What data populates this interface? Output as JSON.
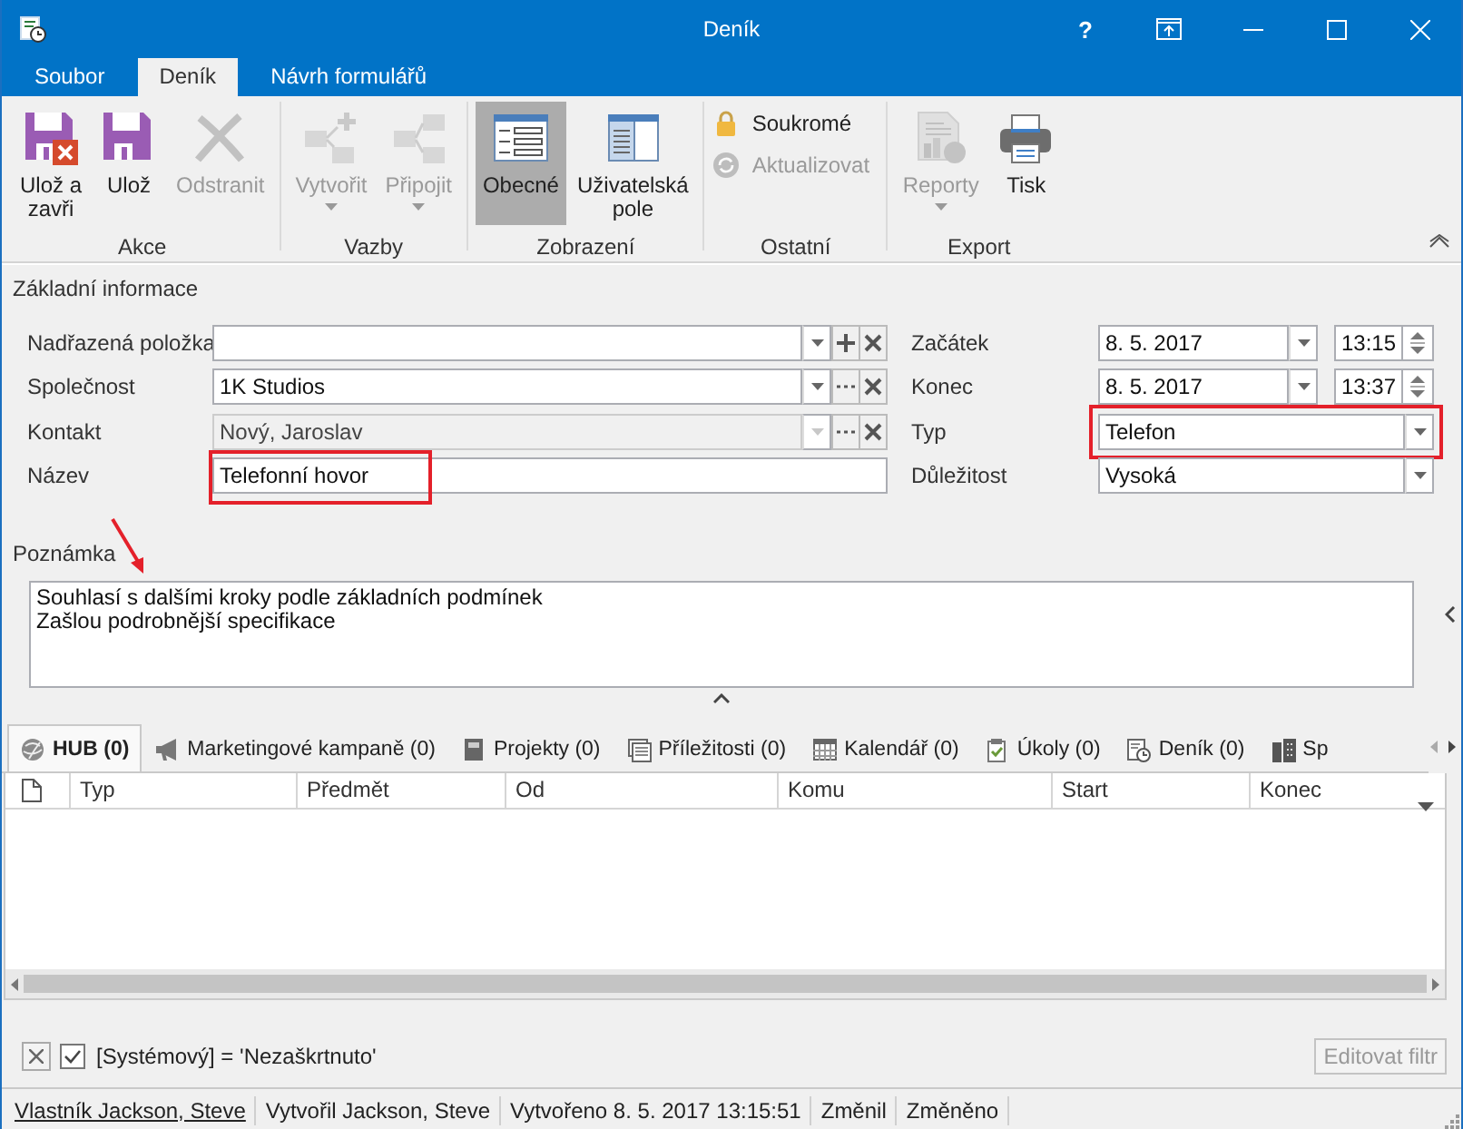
{
  "window": {
    "title": "Deník",
    "help": "?"
  },
  "ribbon": {
    "tabs": [
      {
        "label": "Soubor",
        "selected": false
      },
      {
        "label": "Deník",
        "selected": true
      },
      {
        "label": "Návrh formulářů",
        "selected": false
      }
    ],
    "groups": [
      {
        "label": "Akce",
        "buttons": [
          {
            "kind": "large",
            "label": "Ulož a\nzavři",
            "disabled": false
          },
          {
            "kind": "large",
            "label": "Ulož",
            "disabled": false
          },
          {
            "kind": "large",
            "label": "Odstranit",
            "disabled": true
          }
        ]
      },
      {
        "label": "Vazby",
        "buttons": [
          {
            "kind": "large",
            "label": "Vytvořit",
            "disabled": true,
            "dropdown": true
          },
          {
            "kind": "large",
            "label": "Připojit",
            "disabled": true,
            "dropdown": true
          }
        ]
      },
      {
        "label": "Zobrazení",
        "buttons": [
          {
            "kind": "large",
            "label": "Obecné",
            "disabled": false,
            "selected": true
          },
          {
            "kind": "large",
            "label": "Uživatelská\npole",
            "disabled": false,
            "selected": false
          }
        ]
      },
      {
        "label": "Ostatní",
        "buttons": [
          {
            "kind": "small",
            "label": "Soukromé",
            "disabled": false
          },
          {
            "kind": "small",
            "label": "Aktualizovat",
            "disabled": true
          }
        ]
      },
      {
        "label": "Export",
        "buttons": [
          {
            "kind": "large",
            "label": "Reporty",
            "disabled": true,
            "dropdown": true
          },
          {
            "kind": "large",
            "label": "Tisk",
            "disabled": false
          }
        ]
      }
    ]
  },
  "form": {
    "section": "Základní informace",
    "left": [
      {
        "label": "Nadřazená položka",
        "kind": "lookup",
        "disabled": false,
        "highlighted": false
      },
      {
        "label": "Společnost",
        "kind": "lookup",
        "value": "1K Studios",
        "disabled": false,
        "highlighted": false
      },
      {
        "label": "Kontakt",
        "kind": "lookup",
        "value": "Nový, Jaroslav",
        "disabled": true,
        "highlighted": false
      },
      {
        "label": "Název",
        "kind": "text",
        "value": "Telefonní hovor",
        "disabled": false,
        "highlighted": true
      }
    ],
    "right": [
      {
        "label": "Začátek",
        "kind": "datetime",
        "date": "8. 5. 2017",
        "time": "13:15",
        "highlighted": false
      },
      {
        "label": "Konec",
        "kind": "datetime",
        "date": "8. 5. 2017",
        "time": "13:37",
        "highlighted": false
      },
      {
        "label": "Typ",
        "kind": "combo",
        "value": "Telefon",
        "highlighted": true
      },
      {
        "label": "Důležitost",
        "kind": "combo",
        "value": "Vysoká",
        "highlighted": false
      }
    ]
  },
  "note": {
    "label": "Poznámka",
    "annotated": true,
    "value": "Souhlasí s dalšími kroky podle základních podmínek\nZašlou podrobnější specifikace"
  },
  "related": {
    "tabs": [
      {
        "label": "HUB (0)",
        "selected": true
      },
      {
        "label": "Marketingové kampaně (0)",
        "selected": false
      },
      {
        "label": "Projekty (0)",
        "selected": false
      },
      {
        "label": "Příležitosti (0)",
        "selected": false
      },
      {
        "label": "Kalendář (0)",
        "selected": false
      },
      {
        "label": "Úkoly (0)",
        "selected": false
      },
      {
        "label": "Deník (0)",
        "selected": false
      },
      {
        "label": "Sp",
        "selected": false
      }
    ],
    "columns": [
      "Typ",
      "Předmět",
      "Od",
      "Komu",
      "Start",
      "Konec"
    ]
  },
  "filter": {
    "active": true,
    "text": "[Systémový] = 'Nezaškrtnuto'",
    "edit_label": "Editovat filtr",
    "edit_disabled": true
  },
  "status_bar": [
    {
      "text": "Vlastník Jackson, Steve",
      "kind": "link"
    },
    {
      "text": "Vytvořil Jackson, Steve",
      "kind": "text"
    },
    {
      "text": "Vytvořeno 8. 5. 2017 13:15:51",
      "kind": "text"
    },
    {
      "text": "Změnil",
      "kind": "text"
    },
    {
      "text": "Změněno",
      "kind": "text"
    }
  ]
}
